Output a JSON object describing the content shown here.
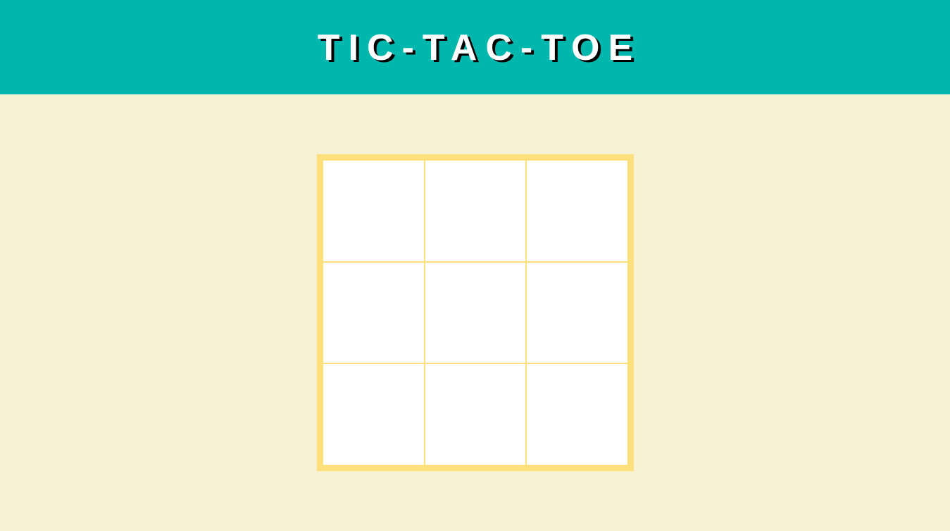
{
  "header": {
    "title": "TIC-TAC-TOE",
    "background_color": "#00b7ad"
  },
  "page": {
    "background_color": "#f8f2d4"
  },
  "board": {
    "border_color": "#fde07c",
    "cells": [
      "",
      "",
      "",
      "",
      "",
      "",
      "",
      "",
      ""
    ]
  }
}
